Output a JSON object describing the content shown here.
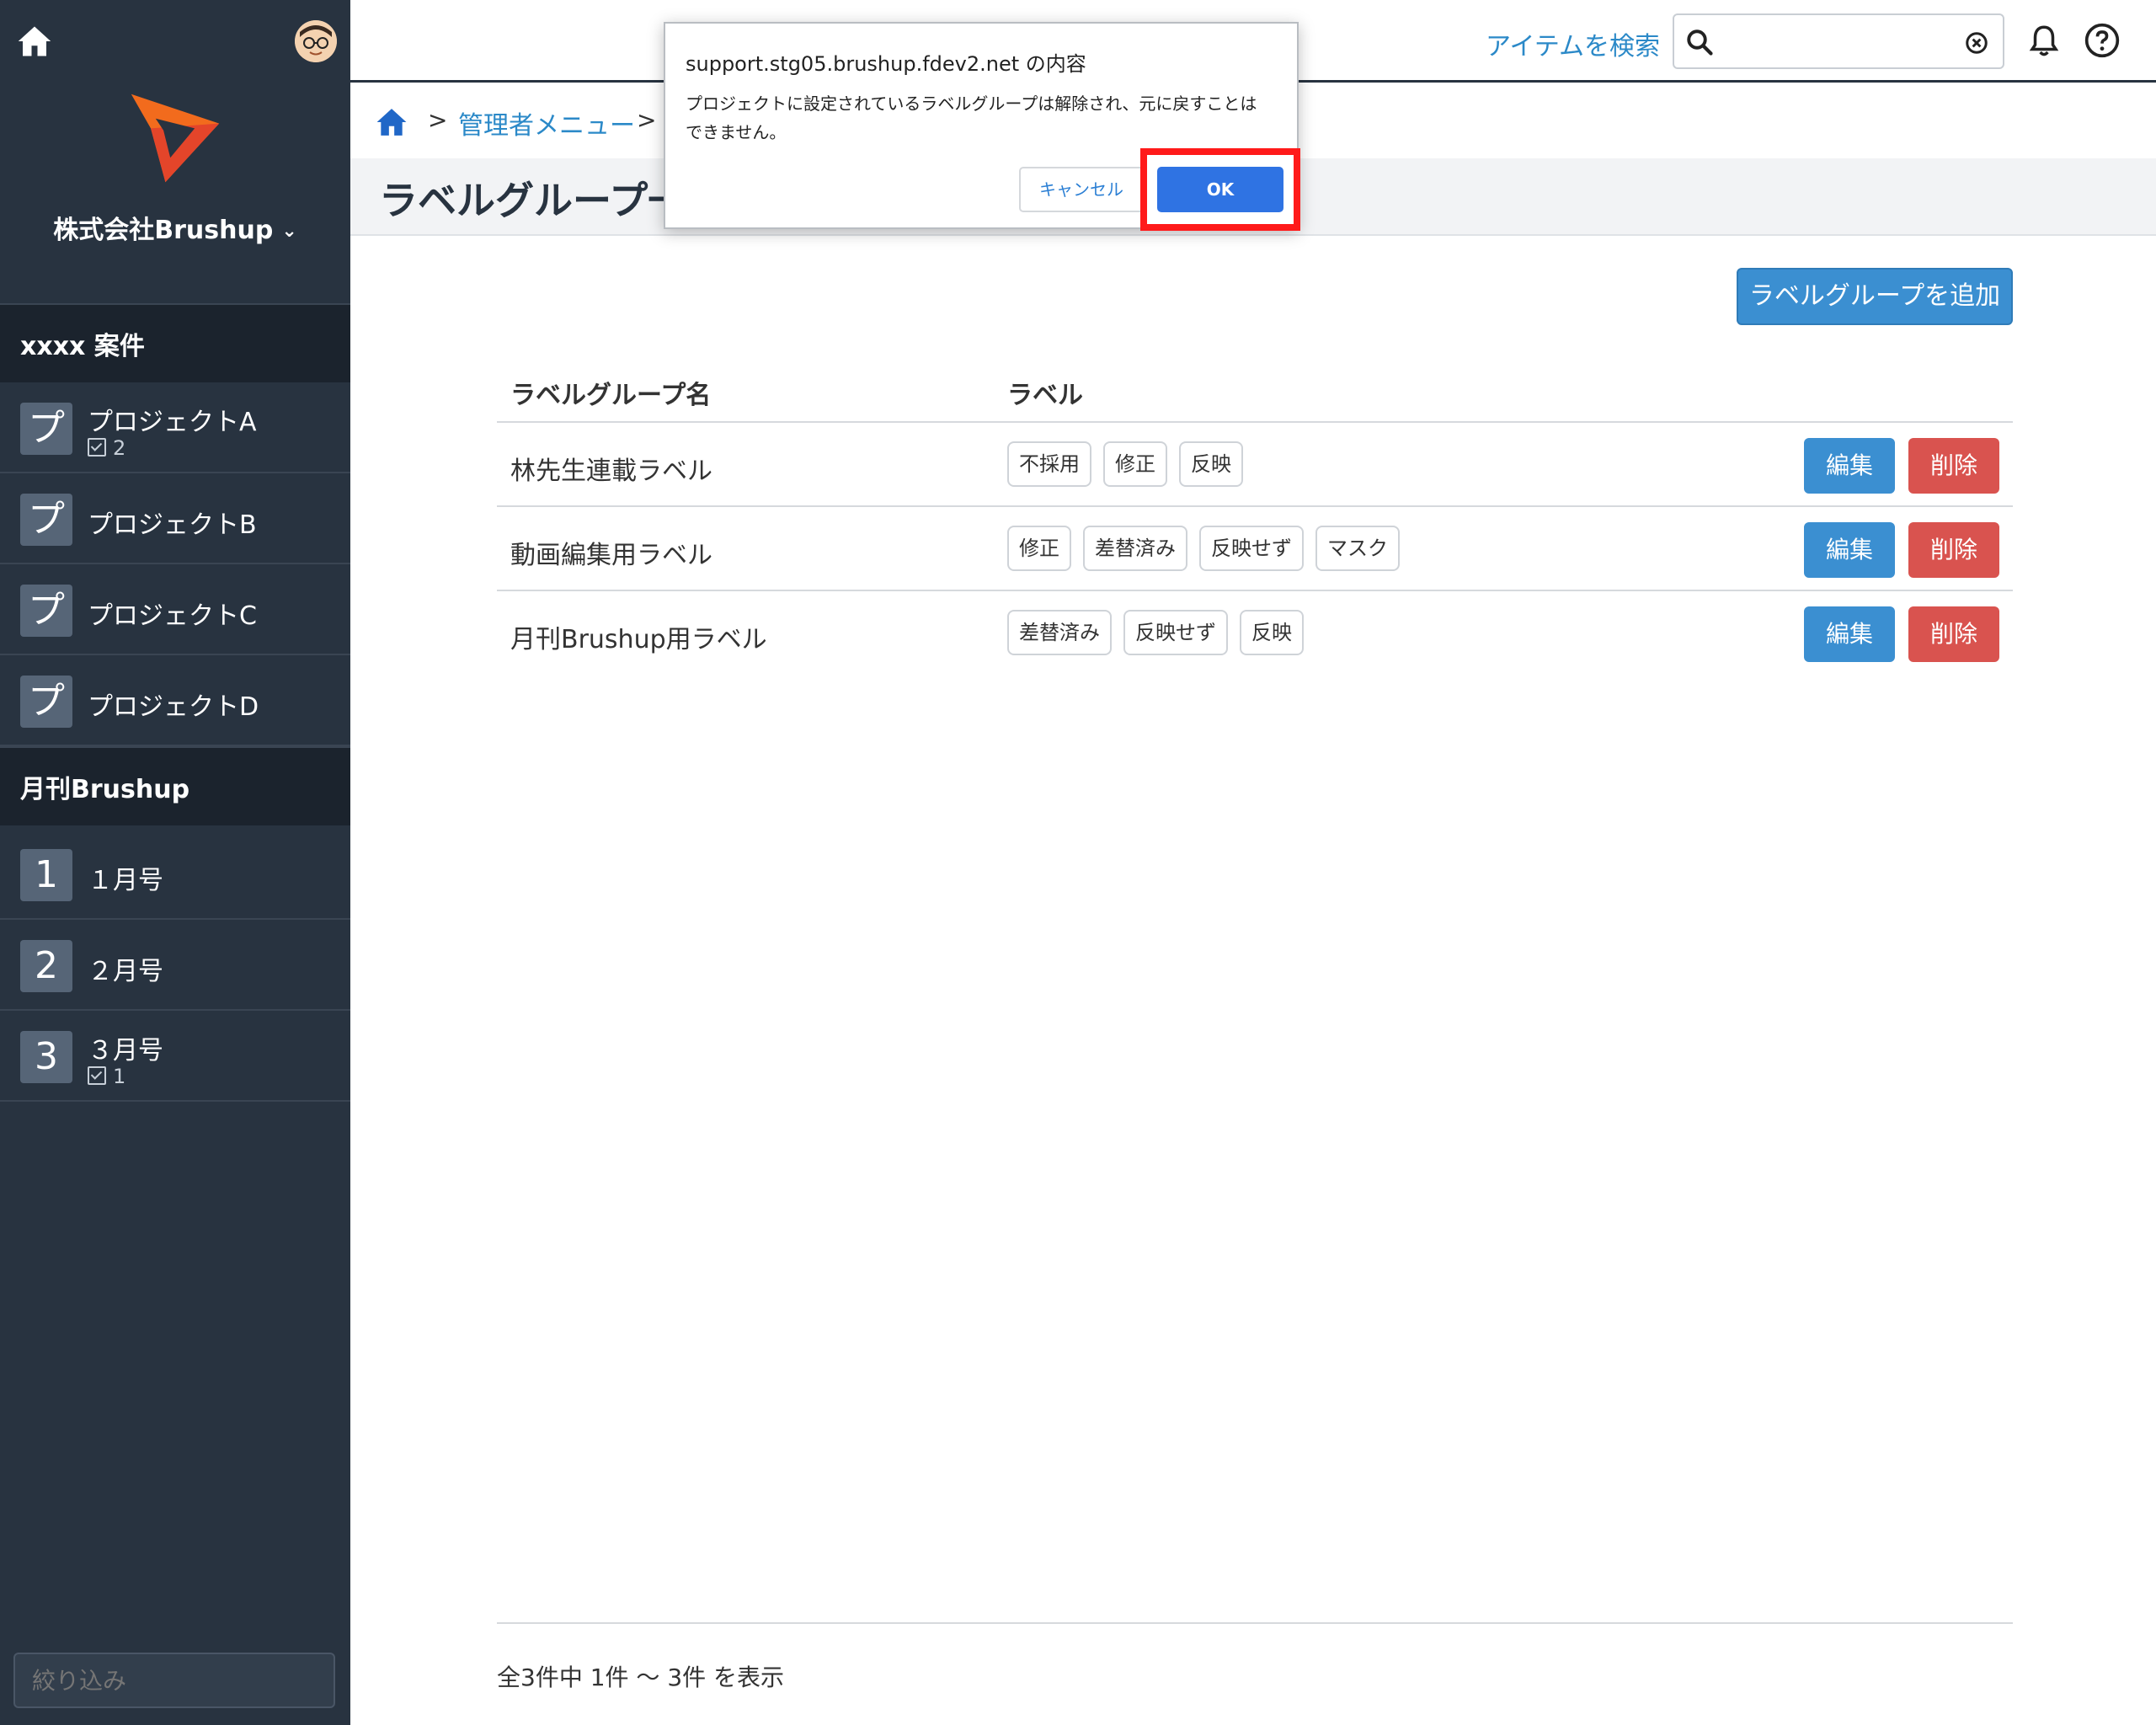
{
  "sidebar": {
    "company": "株式会社Brushup",
    "sections": [
      {
        "title": "xxxx 案件",
        "items": [
          {
            "badge": "プ",
            "name": "プロジェクトA",
            "count": "2"
          },
          {
            "badge": "プ",
            "name": "プロジェクトB",
            "count": ""
          },
          {
            "badge": "プ",
            "name": "プロジェクトC",
            "count": ""
          },
          {
            "badge": "プ",
            "name": "プロジェクトD",
            "count": ""
          }
        ]
      },
      {
        "title": "月刊Brushup",
        "items": [
          {
            "badge": "1",
            "name": "１月号",
            "count": ""
          },
          {
            "badge": "2",
            "name": "２月号",
            "count": ""
          },
          {
            "badge": "3",
            "name": "３月号",
            "count": "1"
          }
        ]
      }
    ],
    "filter_placeholder": "絞り込み"
  },
  "header": {
    "search_link": "アイテムを検索",
    "search_value": ""
  },
  "breadcrumb": {
    "link": "管理者メニュー"
  },
  "page": {
    "title": "ラベルグループ一",
    "add_button": "ラベルグループを追加"
  },
  "table": {
    "headers": [
      "ラベルグループ名",
      "ラベル"
    ],
    "rows": [
      {
        "name": "林先生連載ラベル",
        "labels": [
          "不採用",
          "修正",
          "反映"
        ]
      },
      {
        "name": "動画編集用ラベル",
        "labels": [
          "修正",
          "差替済み",
          "反映せず",
          "マスク"
        ]
      },
      {
        "name": "月刊Brushup用ラベル",
        "labels": [
          "差替済み",
          "反映せず",
          "反映"
        ]
      }
    ],
    "edit_label": "編集",
    "delete_label": "削除"
  },
  "footer": {
    "summary": "全3件中 1件 〜 3件 を表示"
  },
  "dialog": {
    "title": "support.stg05.brushup.fdev2.net の内容",
    "message_line1": "プロジェクトに設定されているラベルグループは解除され、元に戻すことは",
    "message_line2": "できません。",
    "cancel_label": "キャンセル",
    "ok_label": "OK"
  },
  "colors": {
    "sidebar_bg": "#283340",
    "accent_blue": "#3b8fd1",
    "danger_red": "#d9534f",
    "highlight_red": "#ff1a1a"
  },
  "icons": [
    "home-icon",
    "avatar",
    "brushup-logo",
    "chevron-down-icon",
    "search-icon",
    "clear-icon",
    "bell-icon",
    "help-icon",
    "check-icon"
  ]
}
